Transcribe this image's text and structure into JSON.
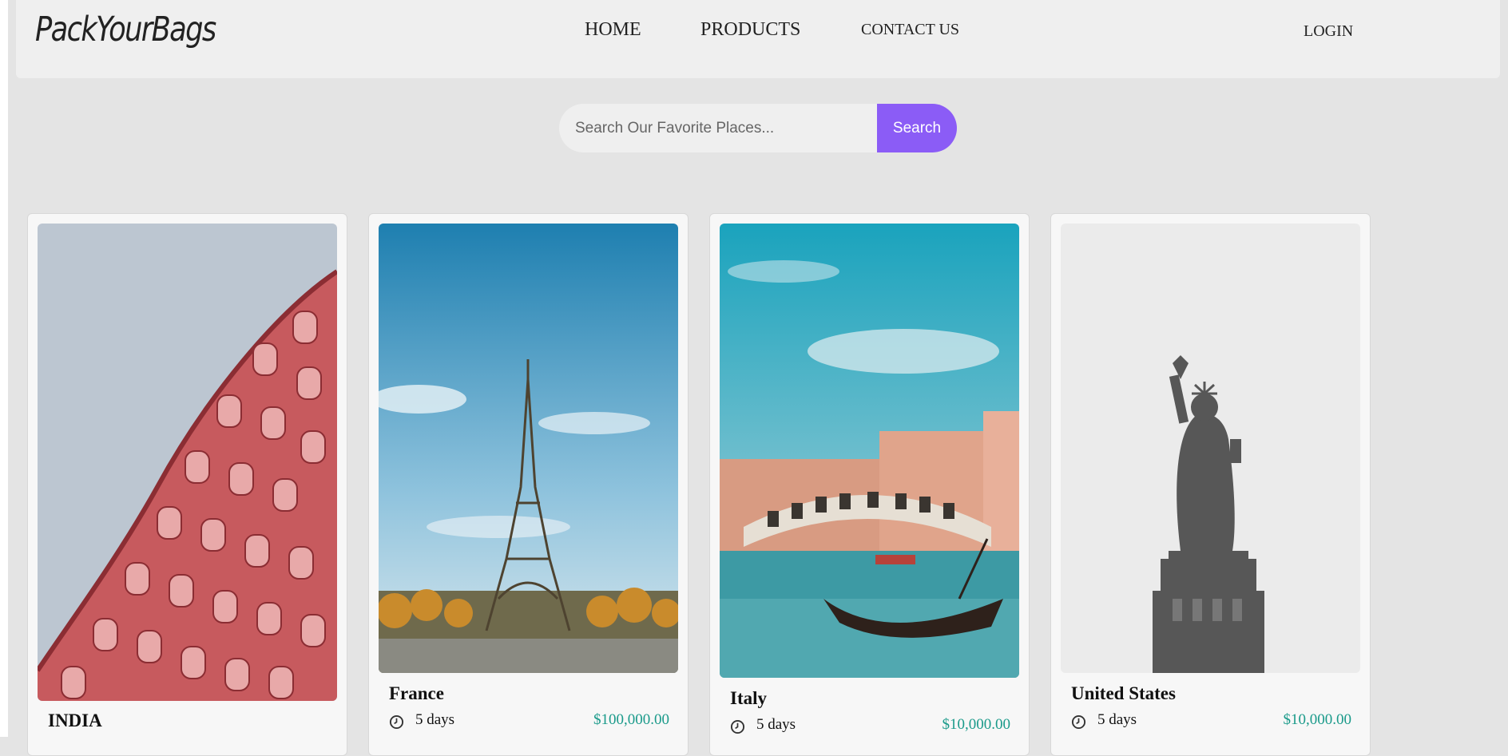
{
  "brand": {
    "name": "PackYourBags"
  },
  "nav": {
    "home": "HOME",
    "products": "PRODUCTS",
    "contact": "CONTACT US",
    "login": "LOGIN"
  },
  "search": {
    "placeholder": "Search Our Favorite Places...",
    "value": "",
    "button_label": "Search"
  },
  "colors": {
    "accent": "#8b5cf6",
    "price": "#1a9a8a",
    "page_bg": "#e4e4e4",
    "navbar_bg": "#efefef"
  },
  "cards": [
    {
      "title": "INDIA",
      "image": "hawa-mahal-photo"
    },
    {
      "title": "France",
      "days": "5 days",
      "price": "$100,000.00",
      "image": "eiffel-tower-photo"
    },
    {
      "title": "Italy",
      "days": "5 days",
      "price": "$10,000.00",
      "image": "venice-rialto-photo"
    },
    {
      "title": "United States",
      "days": "5 days",
      "price": "$10,000.00",
      "image": "statue-of-liberty-photo"
    }
  ]
}
